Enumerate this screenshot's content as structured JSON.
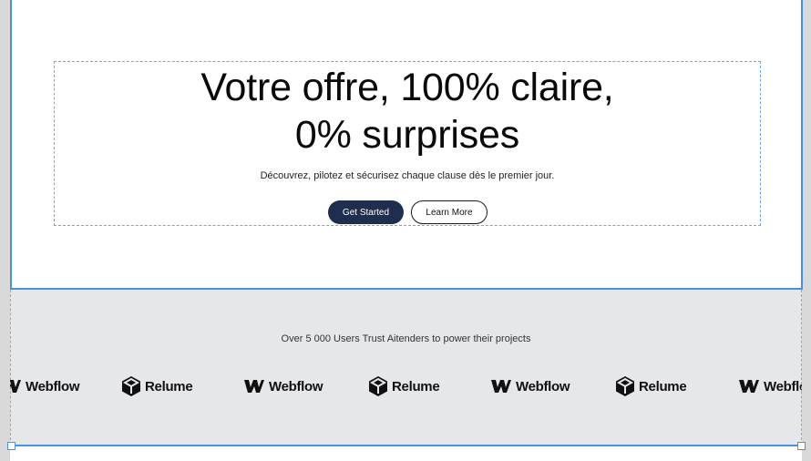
{
  "hero": {
    "title_line1": "Votre offre, 100% claire,",
    "title_line2": "0% surprises",
    "subtitle": "Découvrez, pilotez et sécurisez chaque clause dès le premier jour.",
    "primary_button": "Get Started",
    "secondary_button": "Learn More"
  },
  "logos": {
    "trust_text": "Over 5 000 Users Trust Aitenders to power their projects",
    "items": [
      {
        "name": "Webflow",
        "icon": "webflow-icon"
      },
      {
        "name": "Relume",
        "icon": "relume-icon"
      },
      {
        "name": "Webflow",
        "icon": "webflow-icon"
      },
      {
        "name": "Relume",
        "icon": "relume-icon"
      },
      {
        "name": "Webflow",
        "icon": "webflow-icon"
      },
      {
        "name": "Relume",
        "icon": "relume-icon"
      },
      {
        "name": "Webflow",
        "icon": "webflow-icon"
      }
    ]
  },
  "colors": {
    "primary_button": "#1f2d4f",
    "selection": "#4a90e2",
    "logos_bg": "#e6e7ea"
  }
}
